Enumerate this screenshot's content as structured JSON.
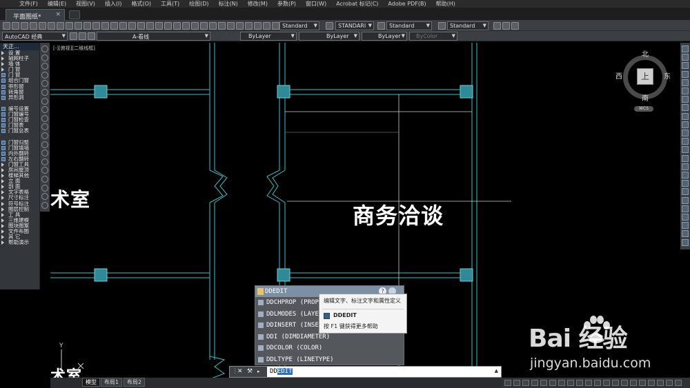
{
  "menubar": {
    "items": [
      "文件(F)",
      "编辑(E)",
      "视图(V)",
      "插入(I)",
      "格式(O)",
      "工具(T)",
      "绘图(D)",
      "标注(N)",
      "修改(M)",
      "参数(P)",
      "窗口(W)",
      "Acrobat 标记(C)",
      "Adobe PDF(B)",
      "帮助(H)"
    ]
  },
  "tabs": {
    "document": "平面图纸*",
    "close": "×"
  },
  "toolbar1": {
    "text_style": "Standard",
    "dim_style": "STANDARI",
    "table_style": "Standard",
    "multileader_style": "Standard"
  },
  "toolbar2": {
    "workspace": "AutoCAD 经典",
    "layer": "A-看线",
    "color": "ByLayer",
    "linetype": "ByLayer",
    "lineweight": "ByLayer",
    "plotstyle": "ByColor"
  },
  "palette": {
    "title": "天正...",
    "items": [
      {
        "label": "设    置",
        "kind": "tri"
      },
      {
        "label": "轴网柱子",
        "kind": "tri"
      },
      {
        "label": "墙    体",
        "kind": "tri"
      },
      {
        "label": "门    窗",
        "kind": "tri"
      },
      {
        "label": "门    窗",
        "kind": "box"
      },
      {
        "label": "组合门窗",
        "kind": "box"
      },
      {
        "label": "带形窗",
        "kind": "box"
      },
      {
        "label": "转角窗",
        "kind": "box"
      },
      {
        "label": "异形洞",
        "kind": "box"
      },
      {
        "label": "",
        "kind": "gap"
      },
      {
        "label": "编号设置",
        "kind": "box"
      },
      {
        "label": "门窗编号",
        "kind": "box"
      },
      {
        "label": "门窗检查",
        "kind": "box"
      },
      {
        "label": "门窗表",
        "kind": "box"
      },
      {
        "label": "门窗总表",
        "kind": "box"
      },
      {
        "label": "",
        "kind": "gap"
      },
      {
        "label": "门窗归整",
        "kind": "box"
      },
      {
        "label": "门窗填墙",
        "kind": "box"
      },
      {
        "label": "内外翻转",
        "kind": "box"
      },
      {
        "label": "左右翻转",
        "kind": "box"
      },
      {
        "label": "门窗工具",
        "kind": "tri"
      },
      {
        "label": "房间屋顶",
        "kind": "tri"
      },
      {
        "label": "楼梯其他",
        "kind": "tri"
      },
      {
        "label": "立    面",
        "kind": "tri"
      },
      {
        "label": "剖    面",
        "kind": "tri"
      },
      {
        "label": "文字表格",
        "kind": "tri"
      },
      {
        "label": "尺寸标注",
        "kind": "tri"
      },
      {
        "label": "符号标注",
        "kind": "tri"
      },
      {
        "label": "图层控制",
        "kind": "tri"
      },
      {
        "label": "工    具",
        "kind": "tri"
      },
      {
        "label": "三维建模",
        "kind": "tri"
      },
      {
        "label": "图块图案",
        "kind": "tri"
      },
      {
        "label": "文件布图",
        "kind": "tri"
      },
      {
        "label": "其    它",
        "kind": "tri"
      },
      {
        "label": "帮助演示",
        "kind": "tri"
      }
    ]
  },
  "canvas": {
    "viewport_label": "[-][俯视][二维线框]",
    "room_a": "术室",
    "room_b": "商务洽谈",
    "room_c": "术室",
    "y_axis": "Y"
  },
  "viewcube": {
    "north": "北",
    "south": "南",
    "west": "西",
    "east": "东",
    "top": "上",
    "wcs": "WCS"
  },
  "autocomplete": {
    "header": "DDEDIT",
    "items": [
      "DDCHPROP (PROPERTIES)",
      "DDLMODES (LAYER)",
      "DDINSERT (INSERT)",
      "DDI (DIMDIAMETER)",
      "DDCOLOR (COLOR)",
      "DDLTYPE (LINETYPE)"
    ]
  },
  "tooltip": {
    "description": "编辑文字、标注文字和属性定义",
    "command": "DDEDIT",
    "help": "按 F1 键获得更多帮助"
  },
  "command_line": {
    "prefix": "DD",
    "highlight": "EDIT"
  },
  "layout_tabs": [
    "模型",
    "布局1",
    "布局2"
  ],
  "watermark": {
    "brand": "Bai   经验",
    "url": "jingyan.baidu.com"
  },
  "colors": {
    "wall": "#35c3c8",
    "column": "#2e8a96",
    "thin": "#d0d0d0"
  }
}
